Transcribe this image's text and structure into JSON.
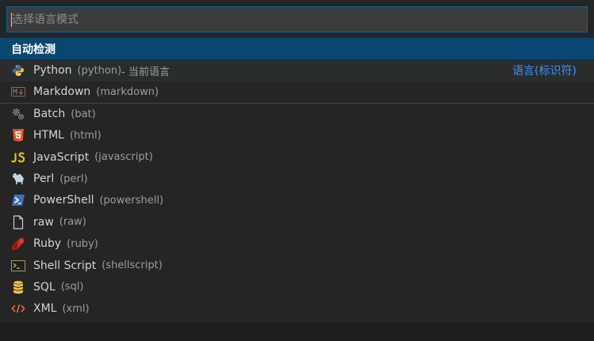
{
  "search": {
    "placeholder": "选择语言模式",
    "value": ""
  },
  "list": {
    "auto_detect_label": "自动检测",
    "items": [
      {
        "label": "Python",
        "id": "(python)",
        "suffix": " - 当前语言",
        "detail": "语言(标识符)",
        "icon": "python-icon"
      },
      {
        "label": "Markdown",
        "id": "(markdown)",
        "icon": "markdown-icon"
      },
      {
        "label": "Batch",
        "id": "(bat)",
        "icon": "gears-icon"
      },
      {
        "label": "HTML",
        "id": "(html)",
        "icon": "html5-icon"
      },
      {
        "label": "JavaScript",
        "id": "(javascript)",
        "icon": "javascript-icon"
      },
      {
        "label": "Perl",
        "id": "(perl)",
        "icon": "perl-camel-icon"
      },
      {
        "label": "PowerShell",
        "id": "(powershell)",
        "icon": "powershell-icon"
      },
      {
        "label": "raw",
        "id": "(raw)",
        "icon": "file-icon"
      },
      {
        "label": "Ruby",
        "id": "(ruby)",
        "icon": "ruby-gem-icon"
      },
      {
        "label": "Shell Script",
        "id": "(shellscript)",
        "icon": "terminal-icon"
      },
      {
        "label": "SQL",
        "id": "(sql)",
        "icon": "database-icon"
      },
      {
        "label": "XML",
        "id": "(xml)",
        "icon": "code-brackets-icon"
      }
    ]
  },
  "colors": {
    "accent": "#0e639c",
    "selection": "#094771",
    "link": "#3794ff",
    "background": "#252526"
  }
}
